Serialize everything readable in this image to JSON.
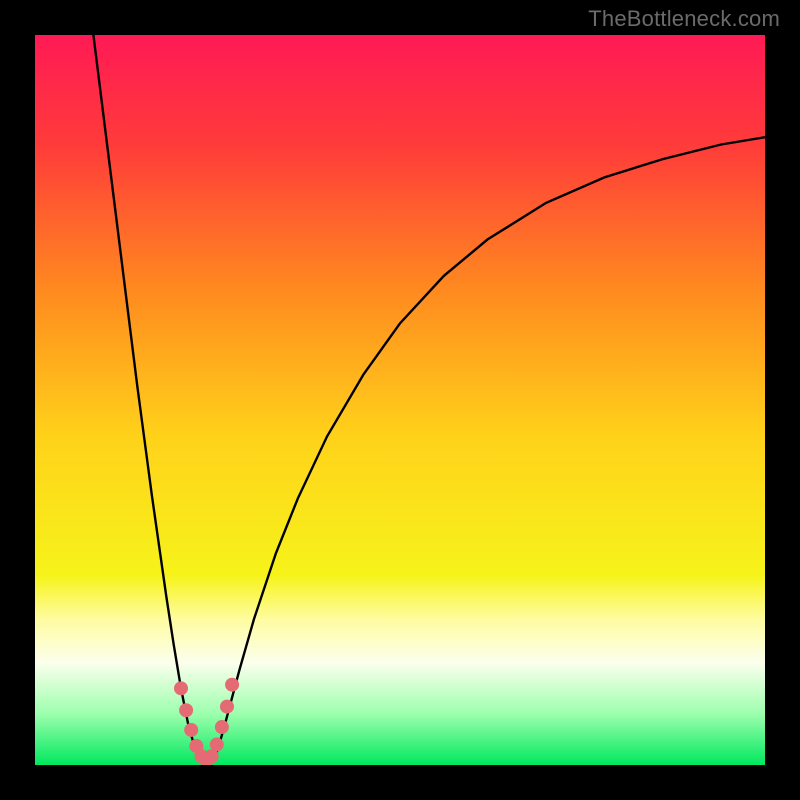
{
  "watermark": "TheBottleneck.com",
  "chart_data": {
    "type": "line",
    "title": "",
    "xlabel": "",
    "ylabel": "",
    "xlim": [
      0,
      100
    ],
    "ylim": [
      0,
      100
    ],
    "grid": false,
    "background_gradient_stops": [
      {
        "offset": 0.0,
        "color": "#ff1a55"
      },
      {
        "offset": 0.15,
        "color": "#ff3b3a"
      },
      {
        "offset": 0.35,
        "color": "#ff8a1f"
      },
      {
        "offset": 0.55,
        "color": "#ffd21a"
      },
      {
        "offset": 0.74,
        "color": "#f6f31a"
      },
      {
        "offset": 0.8,
        "color": "#fffca0"
      },
      {
        "offset": 0.86,
        "color": "#fbffed"
      },
      {
        "offset": 0.93,
        "color": "#9cffad"
      },
      {
        "offset": 1.0,
        "color": "#00e85e"
      }
    ],
    "series": [
      {
        "name": "bottleneck-curve",
        "color": "#000000",
        "width": 2.4,
        "points": [
          {
            "x": 8.0,
            "y": 100.0
          },
          {
            "x": 9.0,
            "y": 92.0
          },
          {
            "x": 10.0,
            "y": 84.0
          },
          {
            "x": 11.0,
            "y": 76.0
          },
          {
            "x": 12.0,
            "y": 68.0
          },
          {
            "x": 13.0,
            "y": 60.0
          },
          {
            "x": 14.0,
            "y": 52.0
          },
          {
            "x": 15.0,
            "y": 44.5
          },
          {
            "x": 16.0,
            "y": 37.0
          },
          {
            "x": 17.0,
            "y": 30.0
          },
          {
            "x": 18.0,
            "y": 23.0
          },
          {
            "x": 19.0,
            "y": 16.5
          },
          {
            "x": 20.0,
            "y": 10.5
          },
          {
            "x": 21.0,
            "y": 5.5
          },
          {
            "x": 22.0,
            "y": 2.0
          },
          {
            "x": 23.0,
            "y": 0.5
          },
          {
            "x": 24.0,
            "y": 0.5
          },
          {
            "x": 25.0,
            "y": 2.0
          },
          {
            "x": 26.0,
            "y": 5.5
          },
          {
            "x": 28.0,
            "y": 13.0
          },
          {
            "x": 30.0,
            "y": 20.0
          },
          {
            "x": 33.0,
            "y": 29.0
          },
          {
            "x": 36.0,
            "y": 36.5
          },
          {
            "x": 40.0,
            "y": 45.0
          },
          {
            "x": 45.0,
            "y": 53.5
          },
          {
            "x": 50.0,
            "y": 60.5
          },
          {
            "x": 56.0,
            "y": 67.0
          },
          {
            "x": 62.0,
            "y": 72.0
          },
          {
            "x": 70.0,
            "y": 77.0
          },
          {
            "x": 78.0,
            "y": 80.5
          },
          {
            "x": 86.0,
            "y": 83.0
          },
          {
            "x": 94.0,
            "y": 85.0
          },
          {
            "x": 100.0,
            "y": 86.0
          }
        ]
      },
      {
        "name": "highlight-markers",
        "color": "#e46a74",
        "marker_radius": 7,
        "type_hint": "scatter",
        "points": [
          {
            "x": 20.0,
            "y": 10.5
          },
          {
            "x": 20.7,
            "y": 7.5
          },
          {
            "x": 21.4,
            "y": 4.8
          },
          {
            "x": 22.1,
            "y": 2.6
          },
          {
            "x": 22.8,
            "y": 1.2
          },
          {
            "x": 23.5,
            "y": 0.6
          },
          {
            "x": 24.2,
            "y": 1.2
          },
          {
            "x": 24.9,
            "y": 2.8
          },
          {
            "x": 25.6,
            "y": 5.2
          },
          {
            "x": 26.3,
            "y": 8.0
          },
          {
            "x": 27.0,
            "y": 11.0
          }
        ]
      }
    ]
  }
}
